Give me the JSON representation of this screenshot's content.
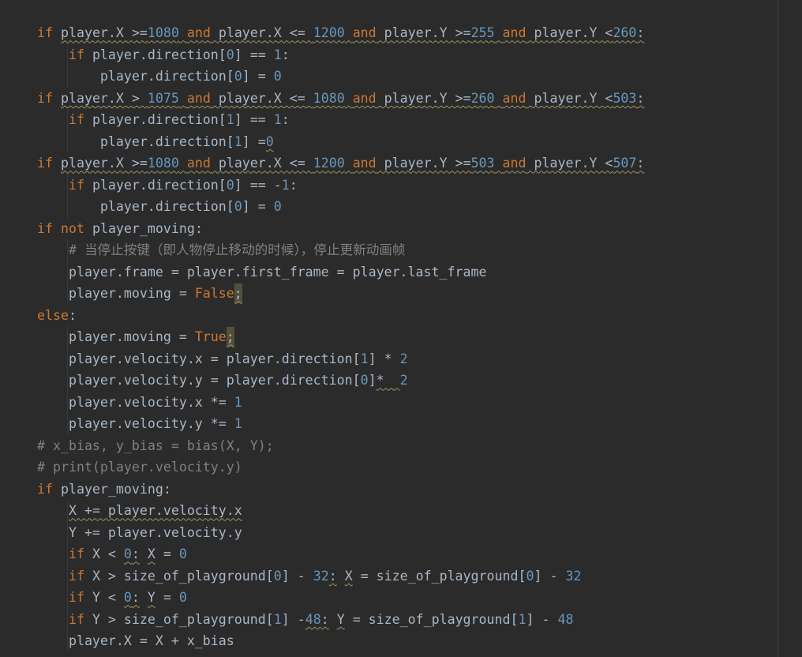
{
  "code": {
    "colors": {
      "background": "#2B2B2B",
      "text": "#A9B7C6",
      "keyword": "#CC7832",
      "number": "#6897BB",
      "comment": "#808080",
      "warning_underline": "#9A9761",
      "highlight": "#52503A",
      "indent_guide": "#3A3A3A",
      "margin_line": "#3E3E3E"
    },
    "lines": [
      [
        {
          "v": "if",
          "c": "#CC7832"
        },
        {
          "v": " "
        },
        {
          "v": "player.X >=",
          "w": true
        },
        {
          "v": "1080",
          "c": "#6897BB",
          "w": true
        },
        {
          "v": " ",
          "w": true
        },
        {
          "v": "and",
          "c": "#CC7832",
          "w": true
        },
        {
          "v": " player.X <= ",
          "w": true
        },
        {
          "v": "1200",
          "c": "#6897BB",
          "w": true
        },
        {
          "v": " ",
          "w": true
        },
        {
          "v": "and",
          "c": "#CC7832",
          "w": true
        },
        {
          "v": " player.Y >=",
          "w": true
        },
        {
          "v": "255",
          "c": "#6897BB",
          "w": true
        },
        {
          "v": " ",
          "w": true
        },
        {
          "v": "and",
          "c": "#CC7832",
          "w": true
        },
        {
          "v": " player.Y <",
          "w": true
        },
        {
          "v": "260",
          "c": "#6897BB",
          "w": true
        },
        {
          "v": ":",
          "w": true
        }
      ],
      [
        {
          "v": "    "
        },
        {
          "v": "if",
          "c": "#CC7832"
        },
        {
          "v": " player.direction["
        },
        {
          "v": "0",
          "c": "#6897BB"
        },
        {
          "v": "] == "
        },
        {
          "v": "1",
          "c": "#6897BB"
        },
        {
          "v": ":"
        }
      ],
      [
        {
          "v": "        player.direction["
        },
        {
          "v": "0",
          "c": "#6897BB"
        },
        {
          "v": "] = "
        },
        {
          "v": "0",
          "c": "#6897BB"
        }
      ],
      [
        {
          "v": "if",
          "c": "#CC7832"
        },
        {
          "v": " "
        },
        {
          "v": "player.X > ",
          "w": true
        },
        {
          "v": "1075",
          "c": "#6897BB",
          "w": true
        },
        {
          "v": " ",
          "w": true
        },
        {
          "v": "and",
          "c": "#CC7832",
          "w": true
        },
        {
          "v": " player.X <= ",
          "w": true
        },
        {
          "v": "1080",
          "c": "#6897BB",
          "w": true
        },
        {
          "v": " ",
          "w": true
        },
        {
          "v": "and",
          "c": "#CC7832",
          "w": true
        },
        {
          "v": " player.Y >=",
          "w": true
        },
        {
          "v": "260",
          "c": "#6897BB",
          "w": true
        },
        {
          "v": " ",
          "w": true
        },
        {
          "v": "and",
          "c": "#CC7832",
          "w": true
        },
        {
          "v": " player.Y <",
          "w": true
        },
        {
          "v": "503",
          "c": "#6897BB",
          "w": true
        },
        {
          "v": ":",
          "w": true
        }
      ],
      [
        {
          "v": "    "
        },
        {
          "v": "if",
          "c": "#CC7832"
        },
        {
          "v": " player.direction["
        },
        {
          "v": "1",
          "c": "#6897BB"
        },
        {
          "v": "] == "
        },
        {
          "v": "1",
          "c": "#6897BB"
        },
        {
          "v": ":"
        }
      ],
      [
        {
          "v": "        player.direction["
        },
        {
          "v": "1",
          "c": "#6897BB"
        },
        {
          "v": "] ="
        },
        {
          "v": "0",
          "c": "#6897BB",
          "w": true
        }
      ],
      [
        {
          "v": "if",
          "c": "#CC7832"
        },
        {
          "v": " "
        },
        {
          "v": "player.X >=",
          "w": true
        },
        {
          "v": "1080",
          "c": "#6897BB",
          "w": true
        },
        {
          "v": " ",
          "w": true
        },
        {
          "v": "and",
          "c": "#CC7832",
          "w": true
        },
        {
          "v": " player.X <= ",
          "w": true
        },
        {
          "v": "1200",
          "c": "#6897BB",
          "w": true
        },
        {
          "v": " ",
          "w": true
        },
        {
          "v": "and",
          "c": "#CC7832",
          "w": true
        },
        {
          "v": " player.Y >=",
          "w": true
        },
        {
          "v": "503",
          "c": "#6897BB",
          "w": true
        },
        {
          "v": " ",
          "w": true
        },
        {
          "v": "and",
          "c": "#CC7832",
          "w": true
        },
        {
          "v": " player.Y <",
          "w": true
        },
        {
          "v": "507",
          "c": "#6897BB",
          "w": true
        },
        {
          "v": ":",
          "w": true
        }
      ],
      [
        {
          "v": "    "
        },
        {
          "v": "if",
          "c": "#CC7832"
        },
        {
          "v": " player.direction["
        },
        {
          "v": "0",
          "c": "#6897BB"
        },
        {
          "v": "] == -"
        },
        {
          "v": "1",
          "c": "#6897BB"
        },
        {
          "v": ":"
        }
      ],
      [
        {
          "v": "        player.direction["
        },
        {
          "v": "0",
          "c": "#6897BB"
        },
        {
          "v": "] = "
        },
        {
          "v": "0",
          "c": "#6897BB"
        }
      ],
      [
        {
          "v": "if",
          "c": "#CC7832"
        },
        {
          "v": " "
        },
        {
          "v": "not",
          "c": "#CC7832"
        },
        {
          "v": " player_moving:"
        }
      ],
      [
        {
          "v": "    "
        },
        {
          "v": "# 当停止按键（即人物停止移动的时候），停止更新动画帧",
          "c": "#808080"
        }
      ],
      [
        {
          "v": "    player.frame = player.first_frame = player.last_frame"
        }
      ],
      [
        {
          "v": "    player.moving = "
        },
        {
          "v": "False",
          "c": "#CC7832"
        },
        {
          "v": ";",
          "w": true,
          "h": true
        }
      ],
      [
        {
          "v": "else",
          "c": "#CC7832"
        },
        {
          "v": ":"
        }
      ],
      [
        {
          "v": "    player.moving = "
        },
        {
          "v": "True",
          "c": "#CC7832"
        },
        {
          "v": ";",
          "w": true,
          "h": true
        }
      ],
      [
        {
          "v": "    player.velocity.x = player.direction["
        },
        {
          "v": "1",
          "c": "#6897BB"
        },
        {
          "v": "] * "
        },
        {
          "v": "2",
          "c": "#6897BB"
        }
      ],
      [
        {
          "v": "    player.velocity.y = player.direction["
        },
        {
          "v": "0",
          "c": "#6897BB"
        },
        {
          "v": "]"
        },
        {
          "v": "*  ",
          "w": true
        },
        {
          "v": "2",
          "c": "#6897BB"
        }
      ],
      [
        {
          "v": "    player.velocity.x *= "
        },
        {
          "v": "1",
          "c": "#6897BB"
        }
      ],
      [
        {
          "v": "    player.velocity.y *= "
        },
        {
          "v": "1",
          "c": "#6897BB"
        }
      ],
      [
        {
          "v": "# x_bias, y_bias = bias(X, Y);",
          "c": "#808080"
        }
      ],
      [
        {
          "v": "# print(player.velocity.y)",
          "c": "#808080"
        }
      ],
      [
        {
          "v": "if",
          "c": "#CC7832"
        },
        {
          "v": " player_moving:"
        }
      ],
      [
        {
          "v": "    "
        },
        {
          "v": "X += player.velocity.x",
          "w": true
        }
      ],
      [
        {
          "v": "    Y += player.velocity.y"
        }
      ],
      [
        {
          "v": "    "
        },
        {
          "v": "if",
          "c": "#CC7832"
        },
        {
          "v": " X < "
        },
        {
          "v": "0",
          "c": "#6897BB",
          "w": true
        },
        {
          "v": ":",
          "w": true
        },
        {
          "v": " "
        },
        {
          "v": "X",
          "w": true
        },
        {
          "v": " = "
        },
        {
          "v": "0",
          "c": "#6897BB"
        }
      ],
      [
        {
          "v": "    "
        },
        {
          "v": "if",
          "c": "#CC7832"
        },
        {
          "v": " X > size_of_playground["
        },
        {
          "v": "0",
          "c": "#6897BB"
        },
        {
          "v": "] - "
        },
        {
          "v": "32",
          "c": "#6897BB"
        },
        {
          "v": ":",
          "w": true
        },
        {
          "v": " "
        },
        {
          "v": "X",
          "w": true
        },
        {
          "v": " = size_of_playground["
        },
        {
          "v": "0",
          "c": "#6897BB"
        },
        {
          "v": "] - "
        },
        {
          "v": "32",
          "c": "#6897BB"
        }
      ],
      [
        {
          "v": "    "
        },
        {
          "v": "if",
          "c": "#CC7832"
        },
        {
          "v": " Y < "
        },
        {
          "v": "0",
          "c": "#6897BB",
          "w": true
        },
        {
          "v": ":",
          "w": true
        },
        {
          "v": " "
        },
        {
          "v": "Y",
          "w": true
        },
        {
          "v": " = "
        },
        {
          "v": "0",
          "c": "#6897BB"
        }
      ],
      [
        {
          "v": "    "
        },
        {
          "v": "if",
          "c": "#CC7832"
        },
        {
          "v": " Y > size_of_playground["
        },
        {
          "v": "1",
          "c": "#6897BB"
        },
        {
          "v": "] -"
        },
        {
          "v": "48",
          "c": "#6897BB",
          "w": true
        },
        {
          "v": ":",
          "w": true
        },
        {
          "v": " "
        },
        {
          "v": "Y",
          "w": true
        },
        {
          "v": " = size_of_playground["
        },
        {
          "v": "1",
          "c": "#6897BB"
        },
        {
          "v": "] - "
        },
        {
          "v": "48",
          "c": "#6897BB"
        }
      ],
      [
        {
          "v": "    player.X = X + x_bias"
        }
      ]
    ]
  }
}
